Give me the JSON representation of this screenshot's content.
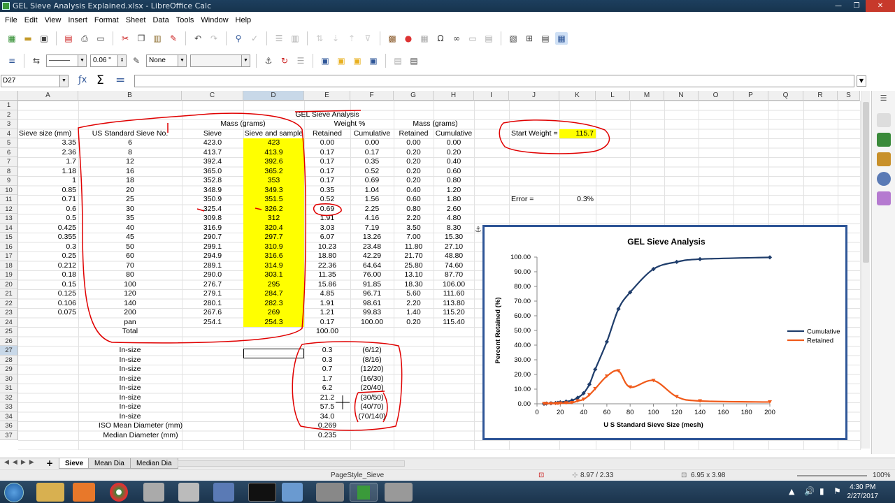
{
  "window": {
    "title": "GEL Sieve Analysis Explained.xlsx - LibreOffice Calc"
  },
  "menu": [
    "File",
    "Edit",
    "View",
    "Insert",
    "Format",
    "Sheet",
    "Data",
    "Tools",
    "Window",
    "Help"
  ],
  "toolbar": {
    "line_width": "0.06 \"",
    "arrow_style": "None"
  },
  "formula": {
    "name_box": "D27",
    "content": ""
  },
  "columns": [
    "A",
    "B",
    "C",
    "D",
    "E",
    "F",
    "G",
    "H",
    "I",
    "J",
    "K",
    "L",
    "M",
    "N",
    "O",
    "P",
    "Q",
    "R",
    "S"
  ],
  "rows": [
    "1",
    "2",
    "3",
    "4",
    "5",
    "6",
    "7",
    "8",
    "9",
    "10",
    "11",
    "12",
    "13",
    "14",
    "15",
    "16",
    "17",
    "18",
    "19",
    "20",
    "21",
    "22",
    "23",
    "24",
    "25",
    "26",
    "27",
    "28",
    "29",
    "30",
    "31",
    "32",
    "33",
    "34",
    "36",
    "37"
  ],
  "sheet": {
    "title": "GEL Sieve Analysis",
    "hdr_mass": "Mass (grams)",
    "hdr_weight": "Weight %",
    "hdr_mass2": "Mass (grams)",
    "hdr_size": "Sieve size (mm)",
    "hdr_us": "US Standard Sieve No.",
    "hdr_sieve": "Sieve",
    "hdr_sample": "Sieve and sample",
    "hdr_retained": "Retained",
    "hdr_cumulative": "Cumulative",
    "hdr_retained2": "Retained",
    "hdr_cumulative2": "Cumulative",
    "start_label": "Start Weight =",
    "start_value": "115.7",
    "error_label": "Error  =",
    "error_value": "0.3%",
    "total_label": "Total",
    "total_value": "100.00",
    "iso_mean_label": "ISO Mean Diameter (mm)",
    "iso_mean_value": "0.269",
    "median_label": "Median Diameter (mm)",
    "median_value": "0.235",
    "data_rows": [
      [
        "3.35",
        "6",
        "423.0",
        "423",
        "0.00",
        "0.00",
        "0.00",
        "0.00"
      ],
      [
        "2.36",
        "8",
        "413.7",
        "413.9",
        "0.17",
        "0.17",
        "0.20",
        "0.20"
      ],
      [
        "1.7",
        "12",
        "392.4",
        "392.6",
        "0.17",
        "0.35",
        "0.20",
        "0.40"
      ],
      [
        "1.18",
        "16",
        "365.0",
        "365.2",
        "0.17",
        "0.52",
        "0.20",
        "0.60"
      ],
      [
        "1",
        "18",
        "352.8",
        "353",
        "0.17",
        "0.69",
        "0.20",
        "0.80"
      ],
      [
        "0.85",
        "20",
        "348.9",
        "349.3",
        "0.35",
        "1.04",
        "0.40",
        "1.20"
      ],
      [
        "0.71",
        "25",
        "350.9",
        "351.5",
        "0.52",
        "1.56",
        "0.60",
        "1.80"
      ],
      [
        "0.6",
        "30",
        "325.4",
        "326.2",
        "0.69",
        "2.25",
        "0.80",
        "2.60"
      ],
      [
        "0.5",
        "35",
        "309.8",
        "312",
        "1.91",
        "4.16",
        "2.20",
        "4.80"
      ],
      [
        "0.425",
        "40",
        "316.9",
        "320.4",
        "3.03",
        "7.19",
        "3.50",
        "8.30"
      ],
      [
        "0.355",
        "45",
        "290.7",
        "297.7",
        "6.07",
        "13.26",
        "7.00",
        "15.30"
      ],
      [
        "0.3",
        "50",
        "299.1",
        "310.9",
        "10.23",
        "23.48",
        "11.80",
        "27.10"
      ],
      [
        "0.25",
        "60",
        "294.9",
        "316.6",
        "18.80",
        "42.29",
        "21.70",
        "48.80"
      ],
      [
        "0.212",
        "70",
        "289.1",
        "314.9",
        "22.36",
        "64.64",
        "25.80",
        "74.60"
      ],
      [
        "0.18",
        "80",
        "290.0",
        "303.1",
        "11.35",
        "76.00",
        "13.10",
        "87.70"
      ],
      [
        "0.15",
        "100",
        "276.7",
        "295",
        "15.86",
        "91.85",
        "18.30",
        "106.00"
      ],
      [
        "0.125",
        "120",
        "279.1",
        "284.7",
        "4.85",
        "96.71",
        "5.60",
        "111.60"
      ],
      [
        "0.106",
        "140",
        "280.1",
        "282.3",
        "1.91",
        "98.61",
        "2.20",
        "113.80"
      ],
      [
        "0.075",
        "200",
        "267.6",
        "269",
        "1.21",
        "99.83",
        "1.40",
        "115.20"
      ],
      [
        "",
        "pan",
        "254.1",
        "254.3",
        "0.17",
        "100.00",
        "0.20",
        "115.40"
      ]
    ],
    "insize_rows": [
      [
        "In-size",
        "0.3",
        "(6/12)"
      ],
      [
        "In-size",
        "0.3",
        "(8/16)"
      ],
      [
        "In-size",
        "0.7",
        "(12/20)"
      ],
      [
        "In-size",
        "1.7",
        "(16/30)"
      ],
      [
        "In-size",
        "6.2",
        "(20/40)"
      ],
      [
        "In-size",
        "21.2",
        "(30/50)"
      ],
      [
        "In-size",
        "57.5",
        "(40/70)"
      ],
      [
        "In-size",
        "34.0",
        "(70/140)"
      ]
    ]
  },
  "tabs": [
    "Sieve",
    "Mean Dia",
    "Median Dia"
  ],
  "status": {
    "page_style": "PageStyle_Sieve",
    "position": "8.97 / 2.33",
    "size": "6.95 x 3.98",
    "zoom": "100%"
  },
  "clock": {
    "time": "4:30 PM",
    "date": "2/27/2017"
  },
  "chart_data": {
    "type": "line",
    "title": "GEL Sieve Analysis",
    "xlabel": "U S Standard Sieve Size (mesh)",
    "ylabel": "Percent Retained (%)",
    "xlim": [
      0,
      200
    ],
    "ylim": [
      0,
      100
    ],
    "x_ticks": [
      "0",
      "20",
      "40",
      "60",
      "80",
      "100",
      "120",
      "140",
      "160",
      "180",
      "200"
    ],
    "y_ticks": [
      "0.00",
      "10.00",
      "20.00",
      "30.00",
      "40.00",
      "50.00",
      "60.00",
      "70.00",
      "80.00",
      "90.00",
      "100.00"
    ],
    "x": [
      6,
      8,
      12,
      16,
      18,
      20,
      25,
      30,
      35,
      40,
      45,
      50,
      60,
      70,
      80,
      100,
      120,
      140,
      200
    ],
    "legend_position": "right",
    "series": [
      {
        "name": "Cumulative",
        "color": "#1f3d6b",
        "values": [
          0.0,
          0.17,
          0.35,
          0.52,
          0.69,
          1.04,
          1.56,
          2.25,
          4.16,
          7.19,
          13.26,
          23.48,
          42.29,
          64.64,
          76.0,
          91.85,
          96.71,
          98.61,
          99.83
        ]
      },
      {
        "name": "Retained",
        "color": "#f05a1a",
        "values": [
          0.0,
          0.17,
          0.17,
          0.17,
          0.17,
          0.35,
          0.52,
          0.69,
          1.91,
          3.03,
          6.07,
          10.23,
          18.8,
          22.36,
          11.35,
          15.86,
          4.85,
          1.91,
          1.21
        ]
      }
    ]
  }
}
